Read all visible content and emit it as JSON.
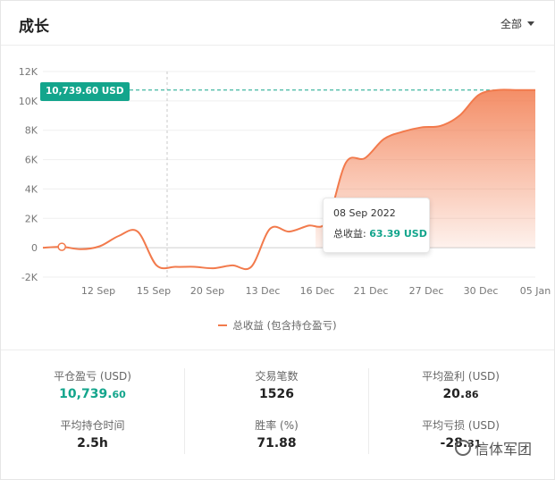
{
  "header": {
    "title": "成长",
    "filter_label": "全部"
  },
  "highlight_badge": "10,739.60 USD",
  "tooltip": {
    "date": "08 Sep 2022",
    "label": "总收益:",
    "value": "63.39 USD"
  },
  "legend": {
    "label": "总收益 (包含持仓盈亏)"
  },
  "colors": {
    "accent": "#13a58c",
    "series": "#f27a4c"
  },
  "chart_data": {
    "type": "area",
    "title": "",
    "xlabel": "",
    "ylabel": "",
    "ylim": [
      -2000,
      12000
    ],
    "yticks": [
      "12K",
      "10K",
      "8K",
      "6K",
      "4K",
      "2K",
      "0",
      "-2K"
    ],
    "ytick_values": [
      12000,
      10000,
      8000,
      6000,
      4000,
      2000,
      0,
      -2000
    ],
    "xticks": [
      "12 Sep",
      "15 Sep",
      "20 Sep",
      "13 Dec",
      "16 Dec",
      "21 Dec",
      "27 Dec",
      "30 Dec",
      "05 Jan"
    ],
    "grid": true,
    "legend_position": "bottom",
    "reference_line": 10739.6,
    "series": [
      {
        "name": "总收益 (包含持仓盈亏)",
        "x": [
          0,
          0.5,
          1,
          1.5,
          2,
          2.5,
          3,
          3.5,
          4,
          4.5,
          5,
          5.5,
          6,
          6.5,
          7,
          7.5,
          8,
          8.5,
          9,
          9.5,
          10,
          10.5,
          11,
          11.5,
          12,
          12.5,
          13
        ],
        "values": [
          0,
          63,
          -100,
          100,
          800,
          1100,
          -1200,
          -1300,
          -1300,
          -1400,
          -1200,
          -1300,
          1300,
          1100,
          1500,
          1800,
          5800,
          6100,
          7400,
          7900,
          8200,
          8300,
          9000,
          10400,
          10739,
          10739,
          10739
        ]
      }
    ]
  },
  "stats": [
    {
      "label": "平仓盈亏 (USD)",
      "value_main": "10,739.",
      "value_small": "60"
    },
    {
      "label": "平均持仓时间",
      "value_main": "2.5h",
      "value_small": ""
    },
    {
      "label": "交易笔数",
      "value_main": "1526",
      "value_small": ""
    },
    {
      "label": "胜率 (%)",
      "value_main": "71.88",
      "value_small": ""
    },
    {
      "label": "平均盈利 (USD)",
      "value_main": "20.",
      "value_small": "86"
    },
    {
      "label": "平均亏损 (USD)",
      "value_main": "-28.",
      "value_small": "31"
    }
  ],
  "watermark": "信体军团"
}
